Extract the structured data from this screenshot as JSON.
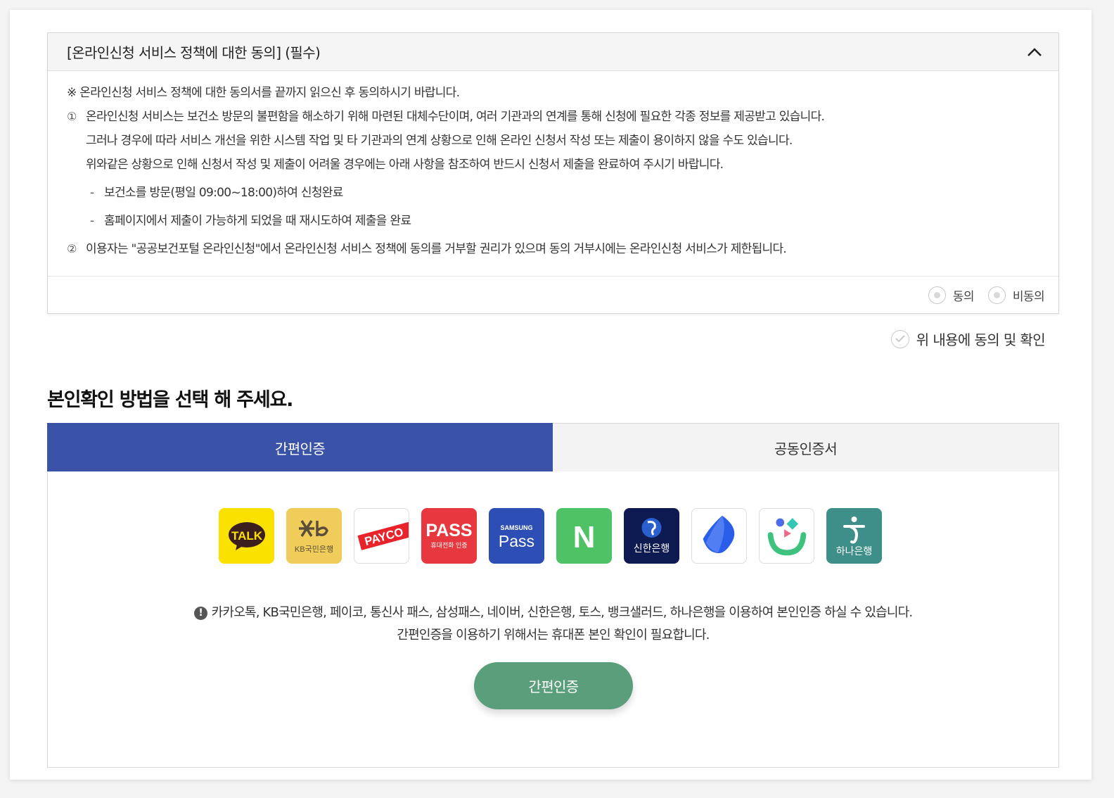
{
  "agreement": {
    "title": "[온라인신청 서비스 정책에 대한 동의] (필수)",
    "notice": "※ 온라인신청 서비스 정책에 대한 동의서를 끝까지 읽으신 후 동의하시기 바랍니다.",
    "item1": {
      "num": "①",
      "lines": [
        "온라인신청 서비스는 보건소 방문의 불편함을 해소하기 위해 마련된 대체수단이며, 여러 기관과의 연계를 통해 신청에 필요한 각종 정보를 제공받고 있습니다.",
        "그러나 경우에 따라 서비스 개선을 위한 시스템 작업 및 타 기관과의 연계 상황으로 인해 온라인 신청서 작성 또는 제출이 용이하지 않을 수도 있습니다.",
        "위와같은 상황으로 인해 신청서 작성 및 제출이 어려울 경우에는 아래 사항을 참조하여 반드시 신청서 제출을 완료하여 주시기 바랍니다."
      ],
      "sub1": "보건소를 방문(평일 09:00~18:00)하여 신청완료",
      "sub2": "홈페이지에서 제출이 가능하게 되었을 때 재시도하여 제출을 완료",
      "dash": "-"
    },
    "item2": {
      "num": "②",
      "text": "이용자는 \"공공보건포털 온라인신청\"에서 온라인신청 서비스 정책에 동의를 거부할 권리가 있으며 동의 거부시에는 온라인신청 서비스가 제한됩니다."
    },
    "agree_label": "동의",
    "disagree_label": "비동의"
  },
  "confirm_label": "위 내용에 동의 및 확인",
  "section_title": "본인확인 방법을 선택 해 주세요.",
  "tabs": [
    {
      "label": "간편인증",
      "active": true
    },
    {
      "label": "공동인증서",
      "active": false
    }
  ],
  "providers": [
    {
      "icon": "kakao-talk-icon",
      "text": "TALK"
    },
    {
      "icon": "kb-bank-icon",
      "text": "KB국민은행"
    },
    {
      "icon": "payco-icon",
      "text": "PAYCO"
    },
    {
      "icon": "pass-icon",
      "text": "PASS",
      "sub": "휴대전화 인증"
    },
    {
      "icon": "samsung-pass-icon",
      "text": "Pass",
      "sub": "SAMSUNG"
    },
    {
      "icon": "naver-icon",
      "text": "N"
    },
    {
      "icon": "shinhan-bank-icon",
      "text": "신한은행"
    },
    {
      "icon": "toss-icon"
    },
    {
      "icon": "banksalad-icon"
    },
    {
      "icon": "hana-bank-icon",
      "text": "하나은행"
    }
  ],
  "info_line1": "카카오톡, KB국민은행, 페이코, 통신사 패스, 삼성패스, 네이버, 신한은행, 토스, 뱅크샐러드, 하나은행을 이용하여 본인인증 하실 수 있습니다.",
  "info_line2": "간편인증을 이용하기 위해서는 휴대폰 본인 확인이 필요합니다.",
  "submit_label": "간편인증",
  "colors": {
    "tab_active": "#3a52a8",
    "button": "#5a9e7c"
  }
}
